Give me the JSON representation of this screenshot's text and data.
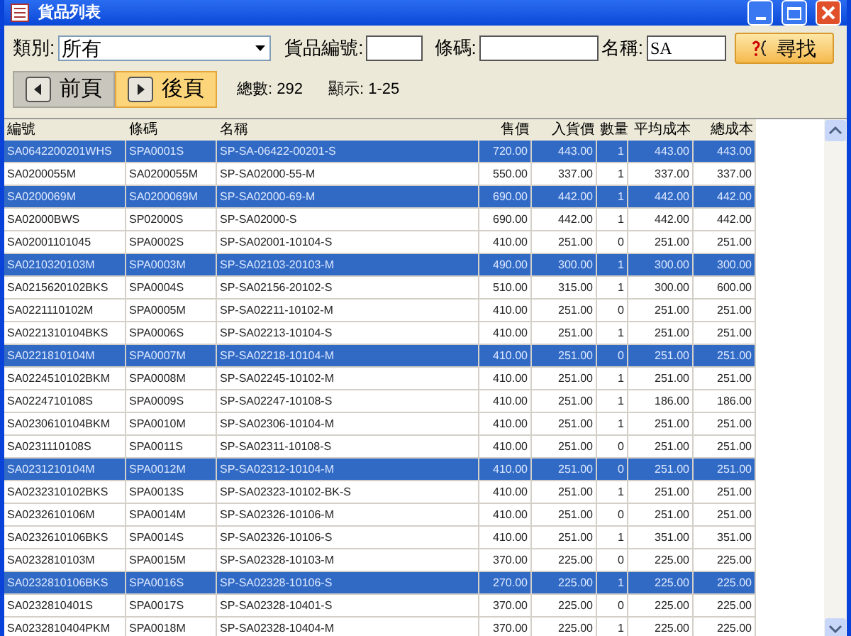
{
  "window": {
    "title": "貨品列表"
  },
  "filters": {
    "category_label": "類別:",
    "category_value": "所有",
    "item_no_label": "貨品編號:",
    "barcode_label": "條碼:",
    "name_label": "名稱:",
    "name_value": "SA",
    "search_button": "尋找"
  },
  "pager": {
    "prev": {
      "label": "前頁",
      "highlighted": false
    },
    "next": {
      "label": "後頁",
      "highlighted": true
    },
    "total": "總數: 292",
    "showing": "顯示: 1-25"
  },
  "table": {
    "columns": [
      "編號",
      "條碼",
      "名稱",
      "售價",
      "入貨價",
      "數量",
      "平均成本",
      "總成本"
    ],
    "rows": [
      {
        "selected": true,
        "cells": [
          "SA0642200201WHS",
          "SPA0001S",
          "SP-SA-06422-00201-S",
          "720.00",
          "443.00",
          "1",
          "443.00",
          "443.00"
        ]
      },
      {
        "selected": false,
        "cells": [
          "SA0200055M",
          "SA0200055M",
          "SP-SA02000-55-M",
          "550.00",
          "337.00",
          "1",
          "337.00",
          "337.00"
        ]
      },
      {
        "selected": true,
        "cells": [
          "SA0200069M",
          "SA0200069M",
          "SP-SA02000-69-M",
          "690.00",
          "442.00",
          "1",
          "442.00",
          "442.00"
        ]
      },
      {
        "selected": false,
        "cells": [
          "SA02000BWS",
          "SP02000S",
          "SP-SA02000-S",
          "690.00",
          "442.00",
          "1",
          "442.00",
          "442.00"
        ]
      },
      {
        "selected": false,
        "cells": [
          "SA02001101045",
          "SPA0002S",
          "SP-SA02001-10104-S",
          "410.00",
          "251.00",
          "0",
          "251.00",
          "251.00"
        ]
      },
      {
        "selected": true,
        "cells": [
          "SA0210320103M",
          "SPA0003M",
          "SP-SA02103-20103-M",
          "490.00",
          "300.00",
          "1",
          "300.00",
          "300.00"
        ]
      },
      {
        "selected": false,
        "cells": [
          "SA0215620102BKS",
          "SPA0004S",
          "SP-SA02156-20102-S",
          "510.00",
          "315.00",
          "1",
          "300.00",
          "600.00"
        ]
      },
      {
        "selected": false,
        "cells": [
          "SA0221110102M",
          "SPA0005M",
          "SP-SA02211-10102-M",
          "410.00",
          "251.00",
          "0",
          "251.00",
          "251.00"
        ]
      },
      {
        "selected": false,
        "cells": [
          "SA0221310104BKS",
          "SPA0006S",
          "SP-SA02213-10104-S",
          "410.00",
          "251.00",
          "1",
          "251.00",
          "251.00"
        ]
      },
      {
        "selected": true,
        "cells": [
          "SA0221810104M",
          "SPA0007M",
          "SP-SA02218-10104-M",
          "410.00",
          "251.00",
          "0",
          "251.00",
          "251.00"
        ]
      },
      {
        "selected": false,
        "cells": [
          "SA0224510102BKM",
          "SPA0008M",
          "SP-SA02245-10102-M",
          "410.00",
          "251.00",
          "1",
          "251.00",
          "251.00"
        ]
      },
      {
        "selected": false,
        "cells": [
          "SA0224710108S",
          "SPA0009S",
          "SP-SA02247-10108-S",
          "410.00",
          "251.00",
          "1",
          "186.00",
          "186.00"
        ]
      },
      {
        "selected": false,
        "cells": [
          "SA0230610104BKM",
          "SPA0010M",
          "SP-SA02306-10104-M",
          "410.00",
          "251.00",
          "1",
          "251.00",
          "251.00"
        ]
      },
      {
        "selected": false,
        "cells": [
          "SA0231110108S",
          "SPA0011S",
          "SP-SA02311-10108-S",
          "410.00",
          "251.00",
          "0",
          "251.00",
          "251.00"
        ]
      },
      {
        "selected": true,
        "cells": [
          "SA0231210104M",
          "SPA0012M",
          "SP-SA02312-10104-M",
          "410.00",
          "251.00",
          "0",
          "251.00",
          "251.00"
        ]
      },
      {
        "selected": false,
        "cells": [
          "SA0232310102BKS",
          "SPA0013S",
          "SP-SA02323-10102-BK-S",
          "410.00",
          "251.00",
          "1",
          "251.00",
          "251.00"
        ]
      },
      {
        "selected": false,
        "cells": [
          "SA0232610106M",
          "SPA0014M",
          "SP-SA02326-10106-M",
          "410.00",
          "251.00",
          "0",
          "251.00",
          "251.00"
        ]
      },
      {
        "selected": false,
        "cells": [
          "SA0232610106BKS",
          "SPA0014S",
          "SP-SA02326-10106-S",
          "410.00",
          "251.00",
          "1",
          "351.00",
          "351.00"
        ]
      },
      {
        "selected": false,
        "cells": [
          "SA0232810103M",
          "SPA0015M",
          "SP-SA02328-10103-M",
          "370.00",
          "225.00",
          "0",
          "225.00",
          "225.00"
        ]
      },
      {
        "selected": true,
        "cells": [
          "SA0232810106BKS",
          "SPA0016S",
          "SP-SA02328-10106-S",
          "270.00",
          "225.00",
          "1",
          "225.00",
          "225.00"
        ]
      },
      {
        "selected": false,
        "cells": [
          "SA0232810401S",
          "SPA0017S",
          "SP-SA02328-10401-S",
          "370.00",
          "225.00",
          "0",
          "225.00",
          "225.00"
        ]
      },
      {
        "selected": false,
        "cells": [
          "SA0232810404PKM",
          "SPA0018M",
          "SP-SA02328-10404-M",
          "370.00",
          "225.00",
          "1",
          "225.00",
          "225.00"
        ]
      }
    ]
  }
}
